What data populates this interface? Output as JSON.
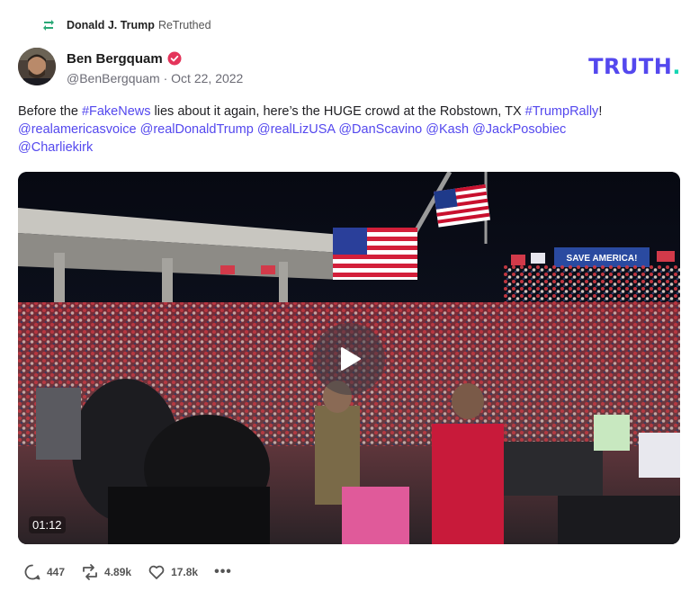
{
  "retruth": {
    "icon": "retruth-icon",
    "name": "Donald J. Trump",
    "label": "ReTruthed"
  },
  "post": {
    "author_name": "Ben Bergquam",
    "verified_icon": "verified-badge-icon",
    "handle": "@BenBergquam",
    "separator": "·",
    "date": "Oct 22, 2022",
    "body": {
      "t1": "Before the ",
      "tag1": "#FakeNews",
      "t2": " lies about it again, here’s the HUGE crowd at the Robstown, TX ",
      "tag2": "#TrumpRally",
      "t3": "!",
      "m1": "@realamericasvoice",
      "m2": "@realDonaldTrump",
      "m3": "@realLizUSA",
      "m4": "@DanScavino",
      "m5": "@Kash",
      "m6": "@JackPosobiec",
      "m7": "@Charliekirk"
    },
    "video": {
      "duration": "01:12",
      "banner": "SAVE AMERICA!",
      "play_icon": "play-icon"
    }
  },
  "logo": {
    "text": "TRUTH",
    "dot": "."
  },
  "actions": {
    "replies": "447",
    "retruths": "4.89k",
    "likes": "17.8k",
    "more": "•••"
  },
  "colors": {
    "brand": "#5448ee",
    "brand_dot": "#16d6b4",
    "retruth_green": "#2aa876",
    "verified": "#e4345a"
  }
}
